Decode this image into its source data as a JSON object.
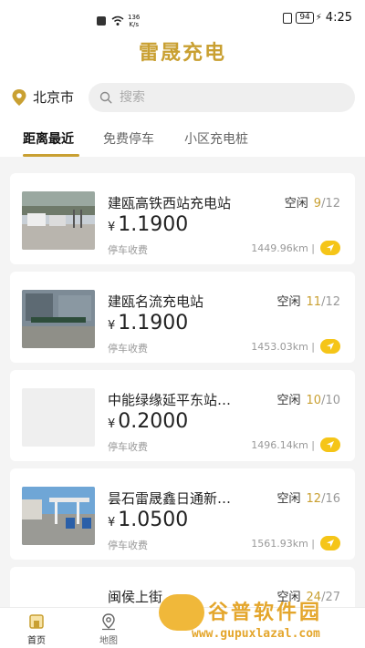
{
  "status_bar": {
    "speed_value": "136",
    "speed_unit": "K/s",
    "battery": "94",
    "time": "4:25"
  },
  "app": {
    "title": "雷晟充电",
    "accent": "#c9a032"
  },
  "location": {
    "city": "北京市"
  },
  "search": {
    "placeholder": "搜索"
  },
  "tabs": [
    {
      "label": "距离最近",
      "active": true
    },
    {
      "label": "免费停车",
      "active": false
    },
    {
      "label": "小区充电桩",
      "active": false
    }
  ],
  "stations": [
    {
      "name": "建瓯高铁西站充电站",
      "status": "空闲",
      "available": "9",
      "total": "/12",
      "currency": "¥",
      "price": "1.1900",
      "parking": "停车收费",
      "distance": "1449.96km |"
    },
    {
      "name": "建瓯名流充电站",
      "status": "空闲",
      "available": "11",
      "total": "/12",
      "currency": "¥",
      "price": "1.1900",
      "parking": "停车收费",
      "distance": "1453.03km |"
    },
    {
      "name": "中能绿缘延平东站…",
      "status": "空闲",
      "available": "10",
      "total": "/10",
      "currency": "¥",
      "price": "0.2000",
      "parking": "停车收费",
      "distance": "1496.14km |"
    },
    {
      "name": "昙石雷晟鑫日通新…",
      "status": "空闲",
      "available": "12",
      "total": "/16",
      "currency": "¥",
      "price": "1.0500",
      "parking": "停车收费",
      "distance": "1561.93km |"
    },
    {
      "name": "闽侯上街…",
      "status": "空闲",
      "available": "24",
      "total": "/27"
    }
  ],
  "bottom_nav": [
    {
      "label": "首页",
      "icon": "home-icon",
      "active": true
    },
    {
      "label": "地图",
      "icon": "map-pin-icon",
      "active": false
    }
  ],
  "watermark": {
    "brand": "谷普软件园",
    "url": "www.gupuxlazal.com"
  }
}
